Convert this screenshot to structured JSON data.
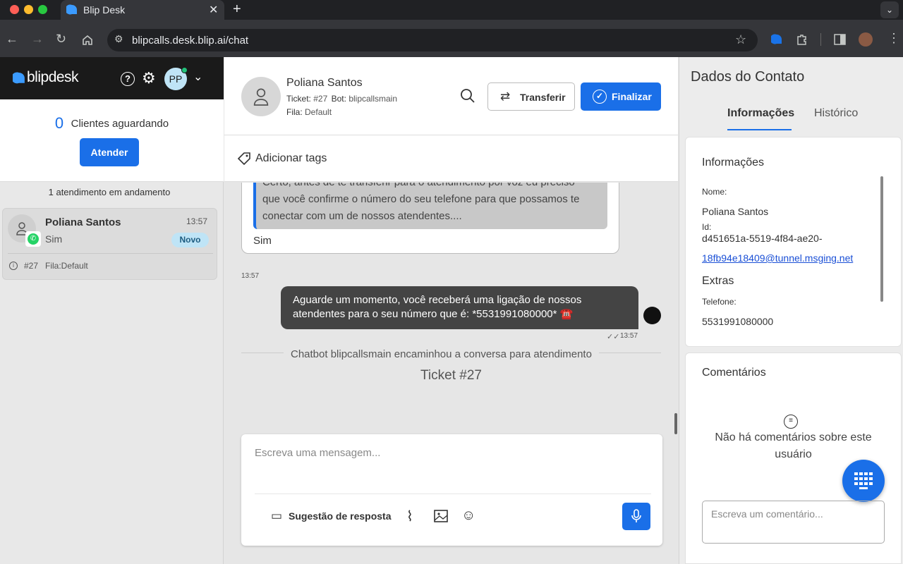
{
  "browser": {
    "tab_title": "Blip Desk",
    "url": "blipcalls.desk.blip.ai/chat"
  },
  "sidebar": {
    "brand": "blipdesk",
    "avatar_initials": "PP",
    "waiting_count": "0",
    "waiting_label": "Clientes aguardando",
    "attend_button": "Atender",
    "in_progress_label": "1 atendimento em andamento",
    "conversation": {
      "name": "Poliana Santos",
      "time": "13:57",
      "last_message": "Sim",
      "badge": "Novo",
      "ticket": "#27",
      "queue": "Fila:Default"
    }
  },
  "chat": {
    "contact_name": "Poliana Santos",
    "ticket_label": "Ticket:",
    "ticket_value": "#27",
    "bot_label": "Bot:",
    "bot_value": "blipcallsmain",
    "queue_label": "Fila:",
    "queue_value": "Default",
    "transfer_button": "Transferir",
    "finish_button": "Finalizar",
    "add_tags": "Adicionar tags",
    "quoted_line1": "Certo, antes de te transferir para o atendimento por voz eu preciso",
    "quoted_line2": "que você confirme o número do seu telefone para que possamos te",
    "quoted_line3": "conectar com um de nossos atendentes....",
    "user_reply": "Sim",
    "user_time": "13:57",
    "bot_message_line1": "Aguarde um momento, você receberá uma ligação de nossos",
    "bot_message_line2": "atendentes para o seu número que é: *5531991080000* ☎️",
    "bot_time": "13:57",
    "system_message": "Chatbot blipcallsmain encaminhou a conversa para atendimento",
    "ticket_divider": "Ticket #27",
    "input_placeholder": "Escreva uma mensagem...",
    "suggestion_button": "Sugestão de resposta"
  },
  "contact": {
    "title": "Dados do Contato",
    "tab_info": "Informações",
    "tab_history": "Histórico",
    "info_heading": "Informações",
    "name_label": "Nome:",
    "name_value": "Poliana Santos",
    "id_label": "Id:",
    "id_value_line1": "d451651a-5519-4f84-ae20-",
    "id_value_line2": "18fb94e18409@tunnel.msging.net",
    "extras_heading": "Extras",
    "phone_label": "Telefone:",
    "phone_value": "5531991080000",
    "comments_heading": "Comentários",
    "no_comments_line1": "Não há comentários sobre este",
    "no_comments_line2": "usuário",
    "comment_placeholder": "Escreva um comentário..."
  },
  "colors": {
    "accent": "#1a6fe8",
    "whatsapp": "#25d366",
    "badge_bg": "#bfe4f6"
  }
}
